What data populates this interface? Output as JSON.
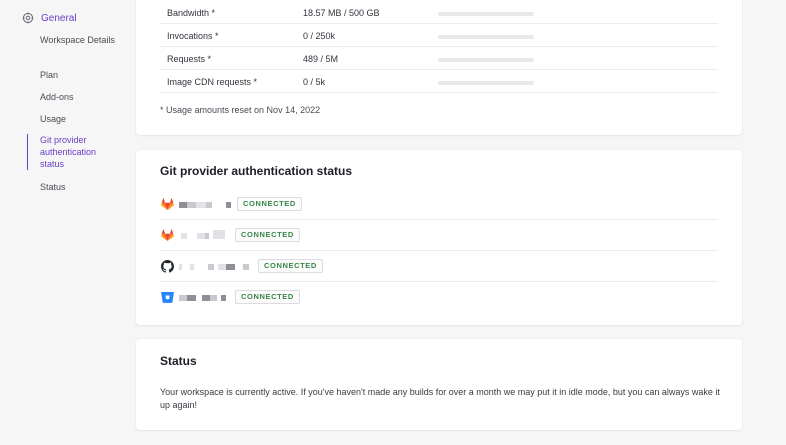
{
  "sidebar": {
    "general_label": "General",
    "items": [
      {
        "label": "Workspace Details"
      },
      {
        "label": "Plan"
      },
      {
        "label": "Add-ons"
      },
      {
        "label": "Usage"
      },
      {
        "label": "Git provider authentication status"
      },
      {
        "label": "Status"
      }
    ]
  },
  "usage": {
    "rows": [
      {
        "name": "Bandwidth *",
        "value": "18.57 MB / 500 GB",
        "progress": 0.0
      },
      {
        "name": "Invocations *",
        "value": "0 / 250k",
        "progress": 0.0
      },
      {
        "name": "Requests *",
        "value": "489 / 5M",
        "progress": 0.0
      },
      {
        "name": "Image CDN requests *",
        "value": "0 / 5k",
        "progress": 0.0
      }
    ],
    "reset_note": "* Usage amounts reset on Nov 14, 2022"
  },
  "git": {
    "title": "Git provider authentication status",
    "providers": [
      {
        "icon": "gitlab-icon",
        "status": "CONNECTED"
      },
      {
        "icon": "gitlab-icon",
        "status": "CONNECTED"
      },
      {
        "icon": "github-icon",
        "status": "CONNECTED"
      },
      {
        "icon": "bitbucket-icon",
        "status": "CONNECTED"
      }
    ]
  },
  "status": {
    "title": "Status",
    "text": "Your workspace is currently active. If you've haven't made any builds for over a month we may put it in idle mode, but you can always wake it up again!"
  },
  "colors": {
    "accent": "#6a3ec6",
    "connected": "#37874a"
  }
}
